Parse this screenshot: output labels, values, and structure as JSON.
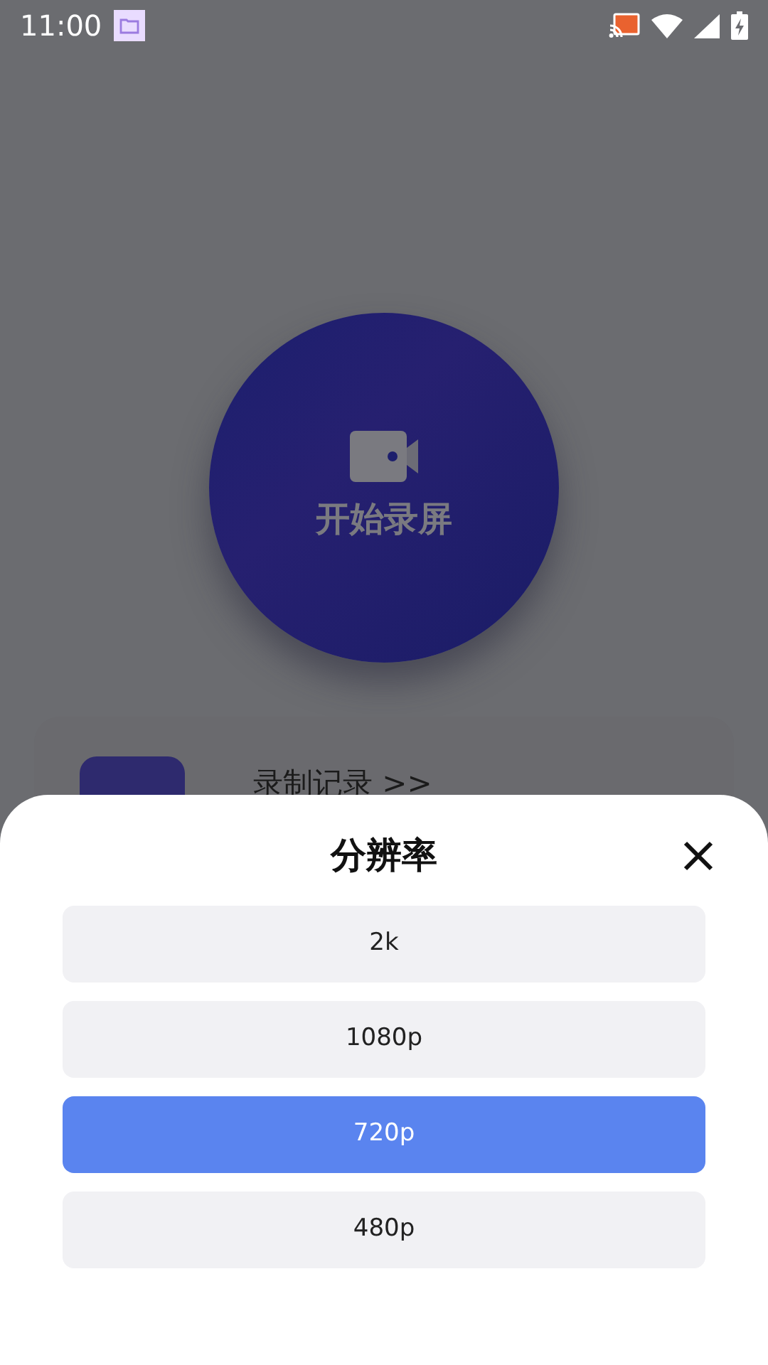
{
  "status_bar": {
    "time": "11:00"
  },
  "record_button": {
    "label": "开始录屏"
  },
  "records_card": {
    "label": "录制记录 >>"
  },
  "resolution_sheet": {
    "title": "分辨率",
    "options": [
      {
        "label": "2k",
        "selected": false
      },
      {
        "label": "1080p",
        "selected": false
      },
      {
        "label": "720p",
        "selected": true
      },
      {
        "label": "480p",
        "selected": false
      }
    ]
  }
}
